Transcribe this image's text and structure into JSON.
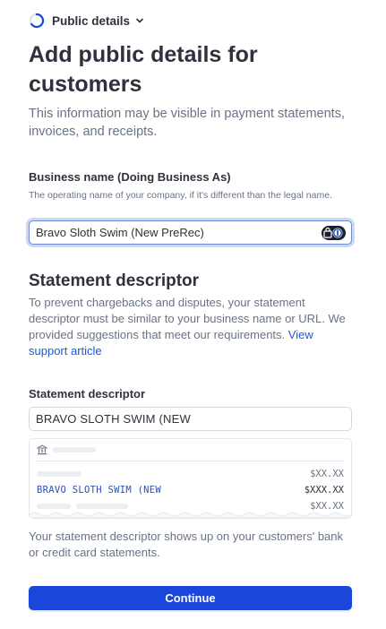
{
  "stepper": {
    "label": "Public details",
    "icons": [
      "progress-ring-icon",
      "chevron-down-icon"
    ]
  },
  "header": {
    "title": "Add public details for customers",
    "subtitle": "This information may be visible in payment statements, invoices, and receipts."
  },
  "business_name": {
    "label": "Business name (Doing Business As)",
    "help": "The operating name of your company, if it's different than the legal name.",
    "value": "Bravo Sloth Swim (New PreRec)",
    "icon": "password-manager-icon"
  },
  "statement_section": {
    "title": "Statement descriptor",
    "description": "To prevent chargebacks and disputes, your statement descriptor must be similar to your business name or URL. We provided suggestions that meet our requirements.",
    "link_text": "View support article"
  },
  "statement_descriptor": {
    "label": "Statement descriptor",
    "value": "BRAVO SLOTH SWIM (NEW"
  },
  "preview": {
    "icon": "bank-icon",
    "rows": [
      {
        "amount": "$XX.XX"
      },
      {
        "descriptor": "BRAVO SLOTH SWIM (NEW",
        "amount": "$XXX.XX"
      },
      {
        "amount": "$XX.XX"
      }
    ]
  },
  "footer_note": "Your statement descriptor shows up on your customers' bank or credit card statements.",
  "actions": {
    "continue_label": "Continue"
  },
  "colors": {
    "primary": "#1a47d9",
    "link": "#1a5ad8",
    "focus": "#6e8bd9",
    "text": "#30313d",
    "muted": "#687385"
  }
}
